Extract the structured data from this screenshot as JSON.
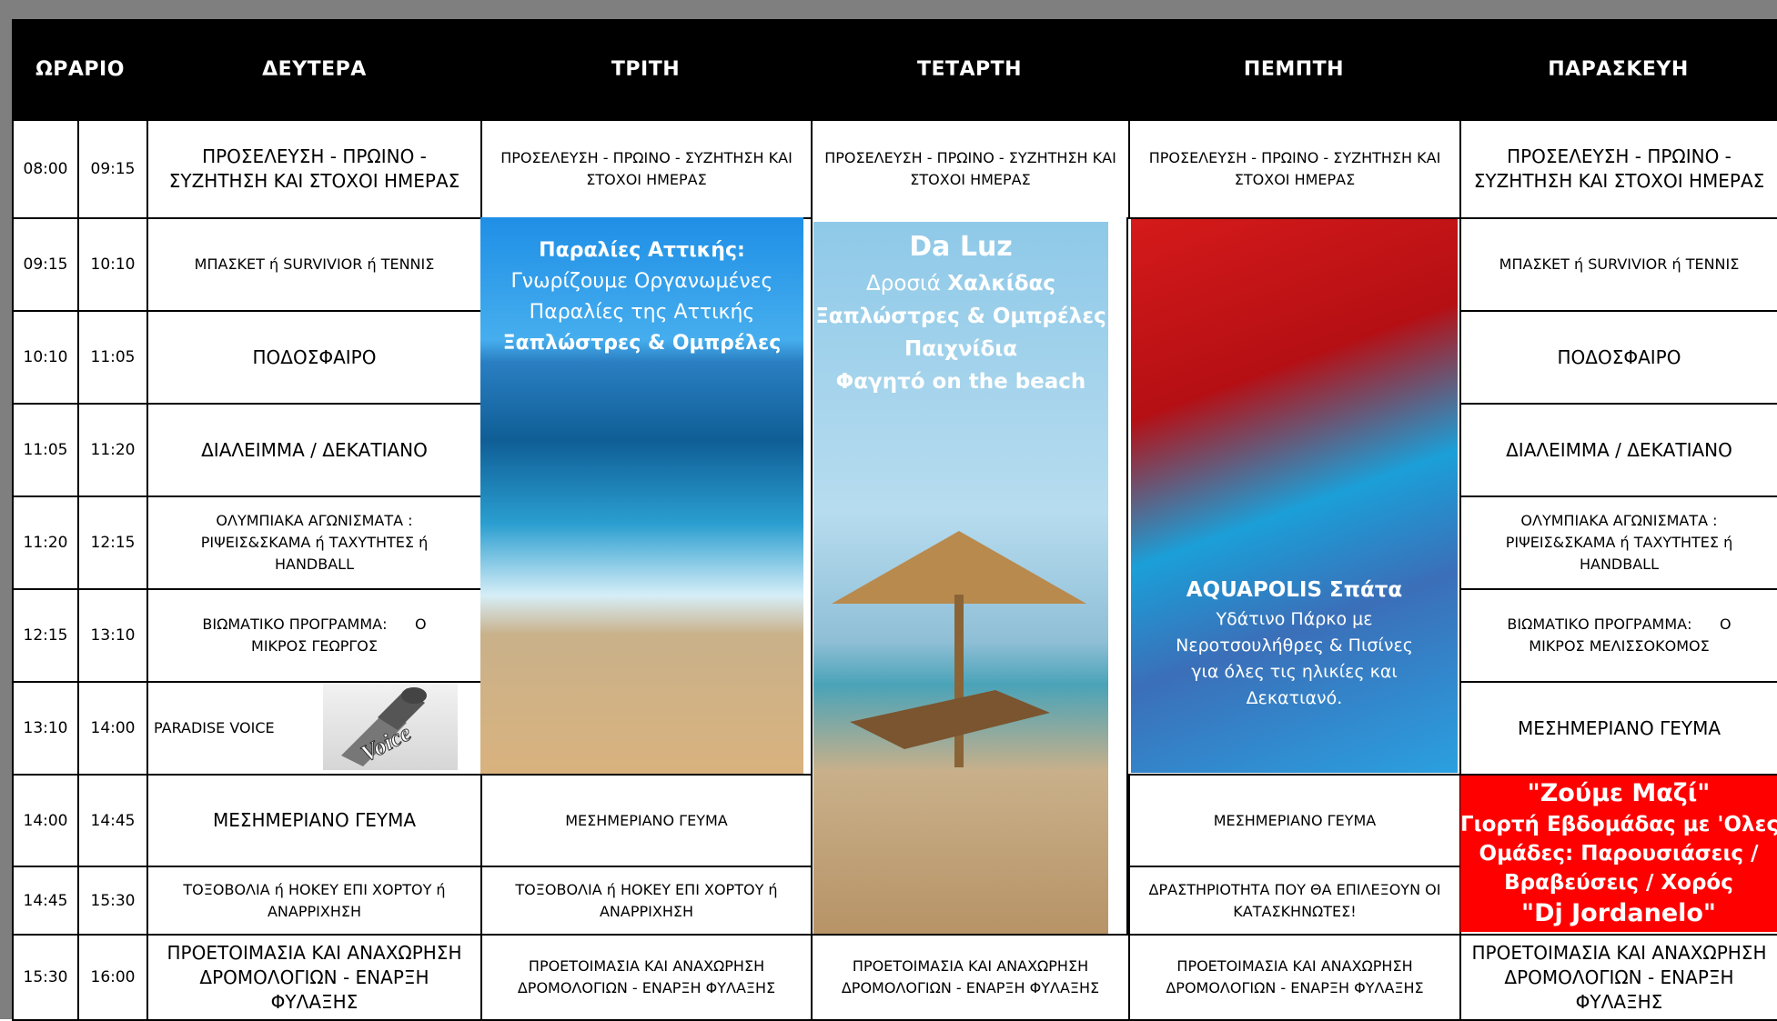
{
  "headers": {
    "time": "ΩΡΑΡΙΟ",
    "mon": "ΔΕΥΤΕΡΑ",
    "tue": "ΤΡΙΤΗ",
    "wed": "ΤΕΤΑΡΤΗ",
    "thu": "ΠΕΜΠΤΗ",
    "fri": "ΠΑΡΑΣΚΕΥΗ"
  },
  "rows": [
    {
      "start": "08:00",
      "end": "09:15"
    },
    {
      "start": "09:15",
      "end": "10:10"
    },
    {
      "start": "10:10",
      "end": "11:05"
    },
    {
      "start": "11:05",
      "end": "11:20"
    },
    {
      "start": "11:20",
      "end": "12:15"
    },
    {
      "start": "12:15",
      "end": "13:10"
    },
    {
      "start": "13:10",
      "end": "14:00"
    },
    {
      "start": "14:00",
      "end": "14:45"
    },
    {
      "start": "14:45",
      "end": "15:30"
    },
    {
      "start": "15:30",
      "end": "16:00"
    }
  ],
  "monday": [
    "ΠΡΟΣΕΛΕΥΣΗ - ΠΡΩΙΝΟ - ΣΥΖΗΤΗΣΗ ΚΑΙ ΣΤΟΧΟΙ ΗΜΕΡΑΣ",
    "ΜΠΑΣΚΕΤ ή SURVIVIOR ή ΤΕΝΝΙΣ",
    "ΠΟΔΟΣΦΑΙΡΟ",
    "ΔΙΑΛΕΙΜΜΑ / ΔΕΚΑΤΙΑΝΟ",
    "ΟΛΥΜΠΙΑΚΑ ΑΓΩΝΙΣΜΑΤΑ : ΡΙΨΕΙΣ&ΣΚΑΜΑ ή ΤΑΧΥΤΗΤΕΣ ή HANDBALL",
    "ΒΙΩΜΑΤΙΚΟ ΠΡΟΓΡΑΜΜΑ:      Ο ΜΙΚΡΟΣ ΓΕΩΡΓΟΣ",
    "PARADISE VOICE",
    "ΜΕΣΗΜΕΡΙΑΝΟ ΓΕΥΜΑ",
    "ΤΟΞΟΒΟΛΙΑ ή ΗΟΚΕΥ ΕΠΙ ΧΟΡΤΟΥ ή ΑΝΑΡΡΙΧΗΣΗ",
    "ΠΡΟΕΤΟΙΜΑΣΙΑ ΚΑΙ ΑΝΑΧΩΡΗΣΗ ΔΡΟΜΟΛΟΓΙΩΝ - ΕΝΑΡΞΗ ΦΥΛΑΞΗΣ"
  ],
  "tuesday": {
    "r0": "ΠΡΟΣΕΛΕΥΣΗ - ΠΡΩΙΝΟ - ΣΥΖΗΤΗΣΗ ΚΑΙ ΣΤΟΧΟΙ ΗΜΕΡΑΣ",
    "r7": "ΜΕΣΗΜΕΡΙΑΝΟ ΓΕΥΜΑ",
    "r8": "ΤΟΞΟΒΟΛΙΑ ή ΗΟΚΕΥ ΕΠΙ ΧΟΡΤΟΥ ή ΑΝΑΡΡΙΧΗΣΗ",
    "r9": "ΠΡΟΕΤΟΙΜΑΣΙΑ ΚΑΙ ΑΝΑΧΩΡΗΣΗ ΔΡΟΜΟΛΟΓΙΩΝ - ΕΝΑΡΞΗ ΦΥΛΑΞΗΣ",
    "excursion": {
      "title": "Παραλίες Αττικής:",
      "line1": "Γνωρίζουμε Οργανωμένες",
      "line2": "Παραλίες της Αττικής",
      "line3": "Ξαπλώστρες & Ομπρέλες"
    }
  },
  "wednesday": {
    "r0": "ΠΡΟΣΕΛΕΥΣΗ - ΠΡΩΙΝΟ - ΣΥΖΗΤΗΣΗ ΚΑΙ ΣΤΟΧΟΙ ΗΜΕΡΑΣ",
    "r9": "ΠΡΟΕΤΟΙΜΑΣΙΑ ΚΑΙ ΑΝΑΧΩΡΗΣΗ ΔΡΟΜΟΛΟΓΙΩΝ - ΕΝΑΡΞΗ ΦΥΛΑΞΗΣ",
    "excursion": {
      "title": "Da Luz",
      "line1_a": "Δροσιά ",
      "line1_b": "Χαλκίδας",
      "line2": "Ξαπλώστρες & Ομπρέλες",
      "line3": "Παιχνίδια",
      "line4": "Φαγητό on the beach"
    }
  },
  "thursday": {
    "r0": "ΠΡΟΣΕΛΕΥΣΗ - ΠΡΩΙΝΟ - ΣΥΖΗΤΗΣΗ ΚΑΙ ΣΤΟΧΟΙ ΗΜΕΡΑΣ",
    "r7": "ΜΕΣΗΜΕΡΙΑΝΟ ΓΕΥΜΑ",
    "r8": "ΔΡΑΣΤΗΡΙΟΤΗΤΑ ΠΟΥ ΘΑ ΕΠΙΛΕΞΟΥΝ ΟΙ ΚΑΤΑΣΚΗΝΩΤΕΣ!",
    "r9": "ΠΡΟΕΤΟΙΜΑΣΙΑ ΚΑΙ ΑΝΑΧΩΡΗΣΗ ΔΡΟΜΟΛΟΓΙΩΝ - ΕΝΑΡΞΗ ΦΥΛΑΞΗΣ",
    "excursion": {
      "title": "AQUAPOLIS Σπάτα",
      "line1": "Υδάτινο Πάρκο με",
      "line2": "Νεροτσουλήθρες & Πισίνες",
      "line3": "για όλες τις ηλικίες και",
      "line4": "Δεκατιανό."
    }
  },
  "friday": {
    "r0": "ΠΡΟΣΕΛΕΥΣΗ - ΠΡΩΙΝΟ - ΣΥΖΗΤΗΣΗ ΚΑΙ ΣΤΟΧΟΙ ΗΜΕΡΑΣ",
    "r1": "ΜΠΑΣΚΕΤ ή SURVIVIOR ή ΤΕΝΝΙΣ",
    "r2": "ΠΟΔΟΣΦΑΙΡΟ",
    "r3": "ΔΙΑΛΕΙΜΜΑ / ΔΕΚΑΤΙΑΝΟ",
    "r4": "ΟΛΥΜΠΙΑΚΑ ΑΓΩΝΙΣΜΑΤΑ : ΡΙΨΕΙΣ&ΣΚΑΜΑ ή ΤΑΧΥΤΗΤΕΣ ή HANDBALL",
    "r5": "ΒΙΩΜΑΤΙΚΟ ΠΡΟΓΡΑΜΜΑ:      Ο ΜΙΚΡΟΣ ΜΕΛΙΣΣΟΚΟΜΟΣ",
    "r6": "ΜΕΣΗΜΕΡΙΑΝΟ ΓΕΥΜΑ",
    "r9": "ΠΡΟΕΤΟΙΜΑΣΙΑ ΚΑΙ ΑΝΑΧΩΡΗΣΗ ΔΡΟΜΟΛΟΓΙΩΝ - ΕΝΑΡΞΗ ΦΥΛΑΞΗΣ",
    "event": {
      "title": "\"Ζούμε Μαζί\"",
      "line1": "Γιορτή Εβδομάδας με 'Ολες τις",
      "line2": "Ομάδες: Παρουσιάσεις /",
      "line3": "Βραβεύσεις / Χορός",
      "line4": "\"Dj Jordanelo\""
    }
  },
  "voice_logo": {
    "text": "Voice"
  },
  "colors": {
    "header_bg": "#000000",
    "frame": "#7f7f7f",
    "event_bg": "#ff0000",
    "event_text": "#ffffff"
  }
}
